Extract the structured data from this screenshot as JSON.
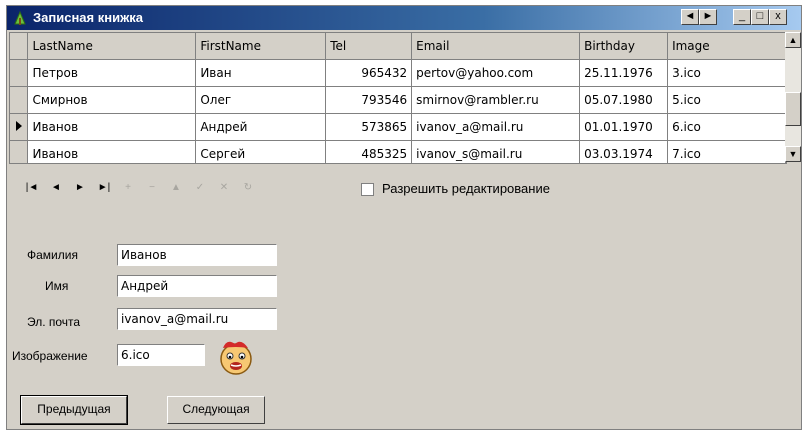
{
  "window": {
    "title": "Записная книжка"
  },
  "titlebar": {
    "nav_left": "◄",
    "nav_right": "►",
    "minimize": "_",
    "maximize": "□",
    "close": "x"
  },
  "grid": {
    "columns": [
      "LastName",
      "FirstName",
      "Tel",
      "Email",
      "Birthday",
      "Image"
    ],
    "rows": [
      {
        "last": "Петров",
        "first": "Иван",
        "tel": "965432",
        "email": "pertov@yahoo.com",
        "birthday": "25.11.1976",
        "image": "3.ico"
      },
      {
        "last": "Смирнов",
        "first": "Олег",
        "tel": "793546",
        "email": "smirnov@rambler.ru",
        "birthday": "05.07.1980",
        "image": "5.ico"
      },
      {
        "last": "Иванов",
        "first": "Андрей",
        "tel": "573865",
        "email": "ivanov_a@mail.ru",
        "birthday": "01.01.1970",
        "image": "6.ico"
      },
      {
        "last": "Иванов",
        "first": "Сергей",
        "tel": "485325",
        "email": "ivanov_s@mail.ru",
        "birthday": "03.03.1974",
        "image": "7.ico"
      }
    ],
    "current_row": 2
  },
  "navigator": {
    "allow_edit_label": "Разрешить редактирование",
    "allow_edit_checked": false
  },
  "form": {
    "lastname_label": "Фамилия",
    "lastname_value": "Иванов",
    "firstname_label": "Имя",
    "firstname_value": "Андрей",
    "email_label": "Эл. почта",
    "email_value": "ivanov_a@mail.ru",
    "image_label": "Изображение",
    "image_value": "6.ico"
  },
  "buttons": {
    "prev": "Предыдущая",
    "next": "Следующая"
  }
}
